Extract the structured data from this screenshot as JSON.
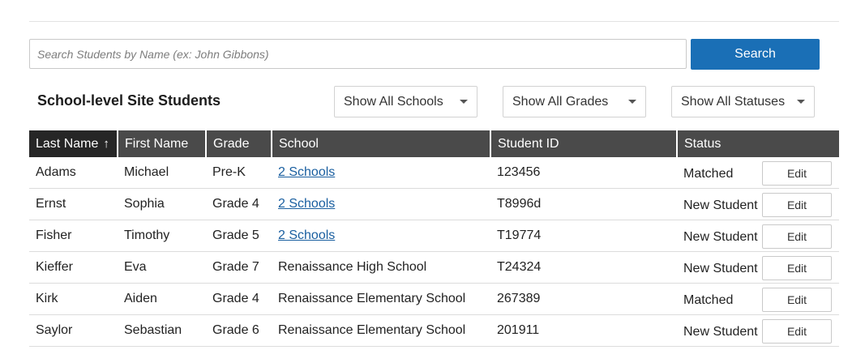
{
  "search": {
    "placeholder": "Search Students by Name (ex: John Gibbons)",
    "value": "",
    "button_label": "Search"
  },
  "section": {
    "title": "School-level Site Students"
  },
  "filters": {
    "school": "Show All Schools",
    "grade": "Show All Grades",
    "status": "Show All Statuses"
  },
  "table": {
    "columns": [
      "Last Name",
      "First Name",
      "Grade",
      "School",
      "Student ID",
      "Status"
    ],
    "sort_column": "Last Name",
    "sort_direction": "ascending",
    "sort_arrow": "↑",
    "rows": [
      {
        "last": "Adams",
        "first": "Michael",
        "grade": "Pre-K",
        "school": "2 Schools",
        "school_is_link": true,
        "id": "123456",
        "status": "Matched",
        "action": "Edit"
      },
      {
        "last": "Ernst",
        "first": "Sophia",
        "grade": "Grade 4",
        "school": "2 Schools",
        "school_is_link": true,
        "id": "T8996d",
        "status": "New Student",
        "action": "Edit"
      },
      {
        "last": "Fisher",
        "first": "Timothy",
        "grade": "Grade 5",
        "school": "2 Schools",
        "school_is_link": true,
        "id": "T19774",
        "status": "New Student",
        "action": "Edit"
      },
      {
        "last": "Kieffer",
        "first": "Eva",
        "grade": "Grade 7",
        "school": "Renaissance High School",
        "school_is_link": false,
        "id": "T24324",
        "status": "New Student",
        "action": "Edit"
      },
      {
        "last": "Kirk",
        "first": "Aiden",
        "grade": "Grade 4",
        "school": "Renaissance Elementary School",
        "school_is_link": false,
        "id": "267389",
        "status": "Matched",
        "action": "Edit"
      },
      {
        "last": "Saylor",
        "first": "Sebastian",
        "grade": "Grade 6",
        "school": "Renaissance Elementary School",
        "school_is_link": false,
        "id": "201911",
        "status": "New Student",
        "action": "Edit"
      }
    ]
  },
  "colors": {
    "accent": "#1a6fb6",
    "header_bg": "#4a4a4a",
    "sorted_header_bg": "#262626",
    "link": "#1a5fa0"
  }
}
